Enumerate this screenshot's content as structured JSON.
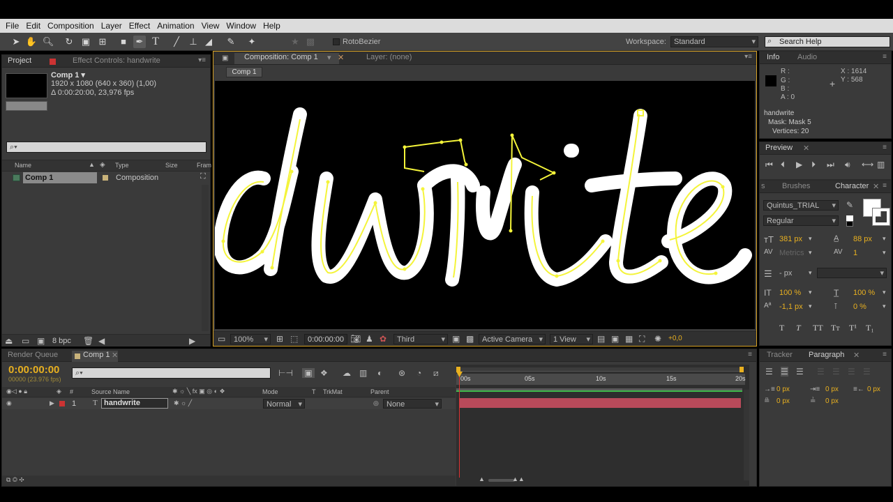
{
  "menu": [
    "File",
    "Edit",
    "Composition",
    "Layer",
    "Effect",
    "Animation",
    "View",
    "Window",
    "Help"
  ],
  "toolbar": {
    "rotobezier": "RotoBezier",
    "workspace_label": "Workspace:",
    "workspace_value": "Standard",
    "search_placeholder": "Search Help"
  },
  "project": {
    "tab_project": "Project",
    "tab_effect": "Effect Controls: handwrite",
    "comp_name": "Comp 1 ▾",
    "comp_res": "1920 x 1080  (640 x 360) (1,00)",
    "comp_dur": "Δ 0:00:20:00, 23,976 fps",
    "search_icon": "⌕▾",
    "col_name": "Name",
    "col_type": "Type",
    "col_size": "Size",
    "col_frame": "Fram",
    "item_name": "Comp 1",
    "item_type": "Composition",
    "bpc": "8 bpc"
  },
  "viewer": {
    "tab_comp": "Composition: Comp 1",
    "tab_layer": "Layer: (none)",
    "breadcrumb": "Comp 1",
    "text": "dwrite",
    "zoom": "100%",
    "timecode": "0:00:00:00",
    "resolution": "Third",
    "camera": "Active Camera",
    "views": "1 View",
    "exposure": "+0,0"
  },
  "info": {
    "tab_info": "Info",
    "tab_audio": "Audio",
    "r": "R :",
    "g": "G :",
    "b": "B :",
    "a": "A : 0",
    "x": "X : 1614",
    "y": "Y : 568",
    "layer": "handwrite",
    "mask": "Mask: Mask 5",
    "vertices": "Vertices: 20"
  },
  "preview": {
    "tab": "Preview"
  },
  "character": {
    "tab_brushes": "Brushes",
    "tab_character": "Character",
    "font": "Quintus_TRIAL",
    "style": "Regular",
    "size": "381 px",
    "leading": "88 px",
    "kerning": "Metrics",
    "tracking": "1",
    "stroke": "- px",
    "vscale": "100 %",
    "hscale": "100 %",
    "baseline": "-1,1 px",
    "tsume": "0 %"
  },
  "timeline": {
    "tab_render": "Render Queue",
    "tab_comp": "Comp 1",
    "timecode": "0:00:00:00",
    "fps": "00000 (23.976 fps)",
    "col_num": "#",
    "col_source": "Source Name",
    "col_mode": "Mode",
    "col_t": "T",
    "col_trkmat": "TrkMat",
    "col_parent": "Parent",
    "layer_num": "1",
    "layer_name": "handwrite",
    "layer_mode": "Normal",
    "layer_parent": "None",
    "ruler": [
      "00s",
      "05s",
      "10s",
      "15s",
      "20s"
    ]
  },
  "paragraph": {
    "tab_tracker": "Tracker",
    "tab_paragraph": "Paragraph",
    "indent1": "0 px",
    "indent2": "0 px",
    "indent3": "0 px",
    "space1": "0 px",
    "space2": "0 px"
  },
  "colors": {
    "accent": "#e8b020",
    "mask": "#f4f43a",
    "layer_bar": "#b84a5a"
  }
}
